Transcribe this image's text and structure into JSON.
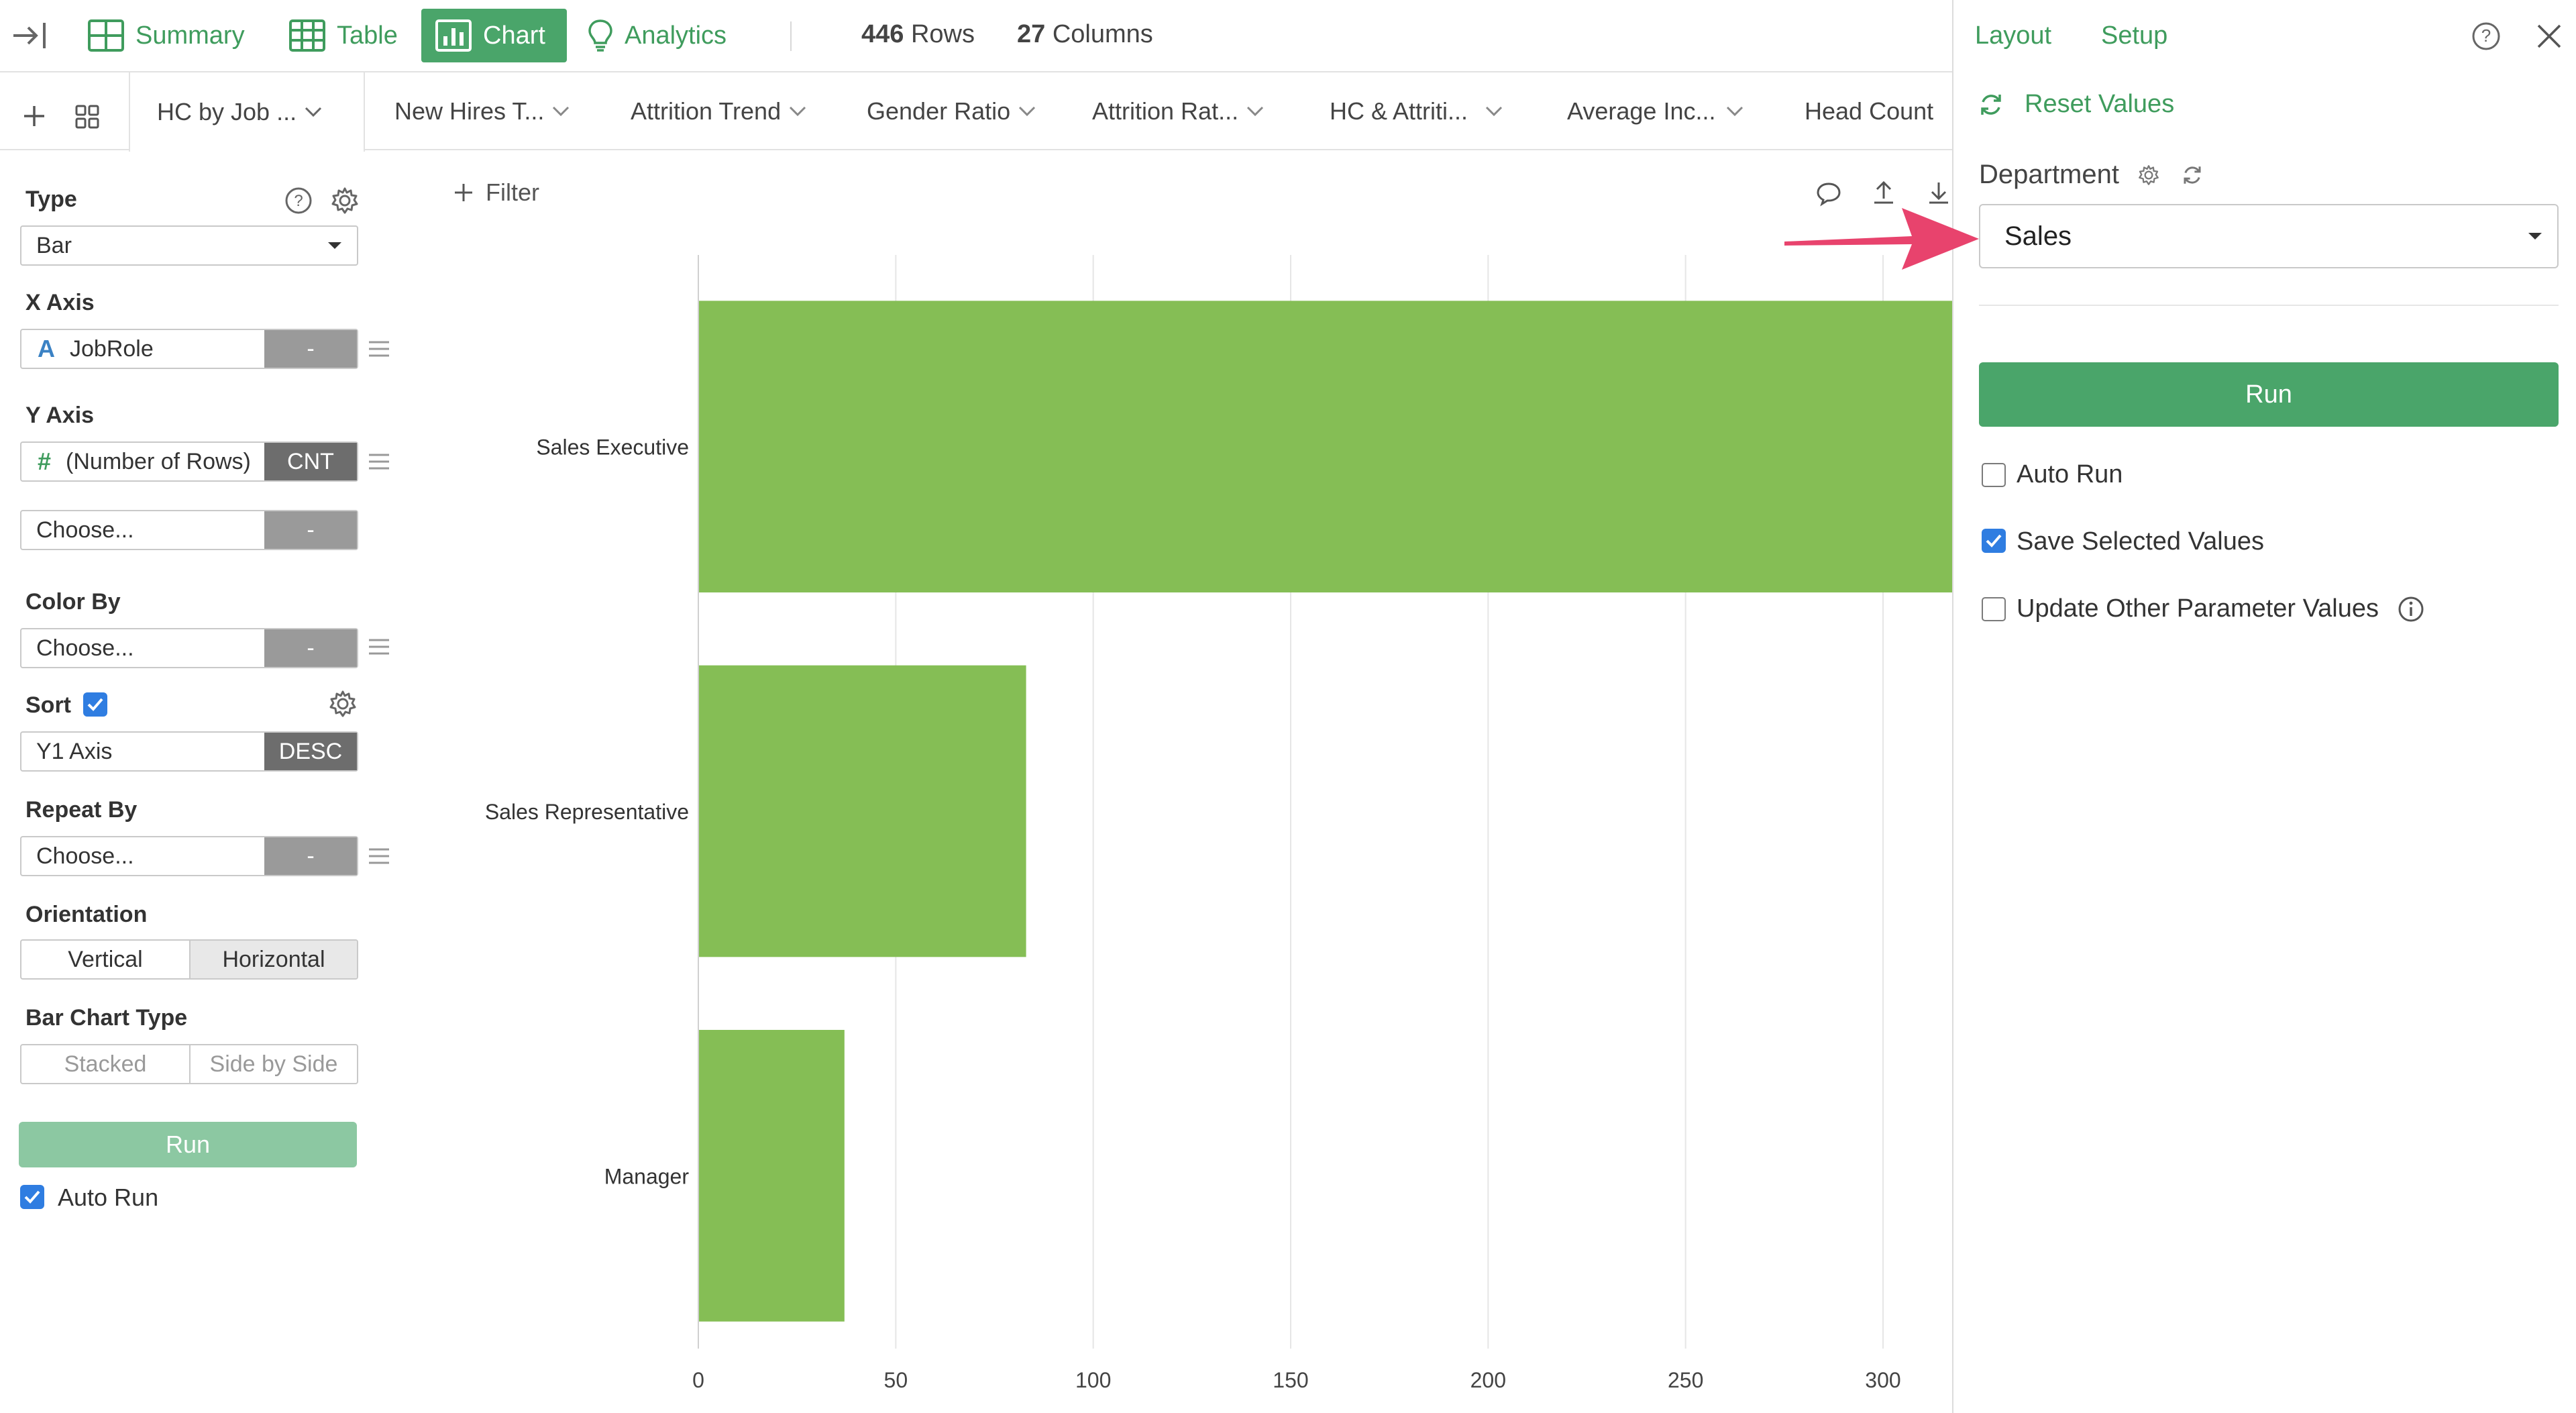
{
  "topbar": {
    "tabs": [
      {
        "label": "Summary",
        "icon": "summary-icon"
      },
      {
        "label": "Table",
        "icon": "table-icon"
      },
      {
        "label": "Chart",
        "icon": "chart-icon",
        "active": true
      },
      {
        "label": "Analytics",
        "icon": "lightbulb-icon"
      }
    ],
    "rows_count": "446",
    "rows_label": "Rows",
    "columns_count": "27",
    "columns_label": "Columns"
  },
  "sheet_tabs": [
    {
      "label": "HC by Job ...",
      "active": true
    },
    {
      "label": "New Hires T..."
    },
    {
      "label": "Attrition Trend"
    },
    {
      "label": "Gender Ratio"
    },
    {
      "label": "Attrition Rat..."
    },
    {
      "label": "HC & Attriti..."
    },
    {
      "label": "Average Inc..."
    },
    {
      "label": "Head Count"
    }
  ],
  "config": {
    "type_label": "Type",
    "type_value": "Bar",
    "x_axis_label": "X Axis",
    "x_axis_field": "JobRole",
    "x_axis_agg": "-",
    "y_axis_label": "Y Axis",
    "y_axis_field": "(Number of Rows)",
    "y_axis_agg": "CNT",
    "y2_field": "Choose...",
    "y2_agg": "-",
    "color_by_label": "Color By",
    "color_by_field": "Choose...",
    "color_by_agg": "-",
    "sort_label": "Sort",
    "sort_field": "Y1 Axis",
    "sort_order": "DESC",
    "repeat_by_label": "Repeat By",
    "repeat_by_field": "Choose...",
    "repeat_by_agg": "-",
    "orientation_label": "Orientation",
    "orientation_options": [
      "Vertical",
      "Horizontal"
    ],
    "orientation_selected": "Horizontal",
    "bar_chart_type_label": "Bar Chart Type",
    "bar_chart_type_options": [
      "Stacked",
      "Side by Side"
    ],
    "run_label": "Run",
    "auto_run_label": "Auto Run",
    "auto_run_checked": true
  },
  "filter_label": "Filter",
  "chart_data": {
    "type": "bar",
    "orientation": "horizontal",
    "categories": [
      "Sales Executive",
      "Sales Representative",
      "Manager"
    ],
    "values": [
      326,
      83,
      37
    ],
    "xlim": [
      0,
      320
    ],
    "x_ticks": [
      0,
      50,
      100,
      150,
      200,
      250,
      300
    ],
    "grid": true,
    "bar_color": "#85be55"
  },
  "right_panel": {
    "layout_label": "Layout",
    "setup_label": "Setup",
    "reset_label": "Reset Values",
    "department_label": "Department",
    "department_value": "Sales",
    "run_label": "Run",
    "options": [
      {
        "label": "Auto Run",
        "checked": false
      },
      {
        "label": "Save Selected Values",
        "checked": true
      },
      {
        "label": "Update Other Parameter Values",
        "checked": false
      }
    ]
  },
  "colors": {
    "accent_green": "#3f9c5d",
    "run_button": "#4aa56a",
    "run_button_disabled": "#8cc8a2",
    "arrow": "#e8436d",
    "checkbox_blue": "#2f7de1"
  }
}
